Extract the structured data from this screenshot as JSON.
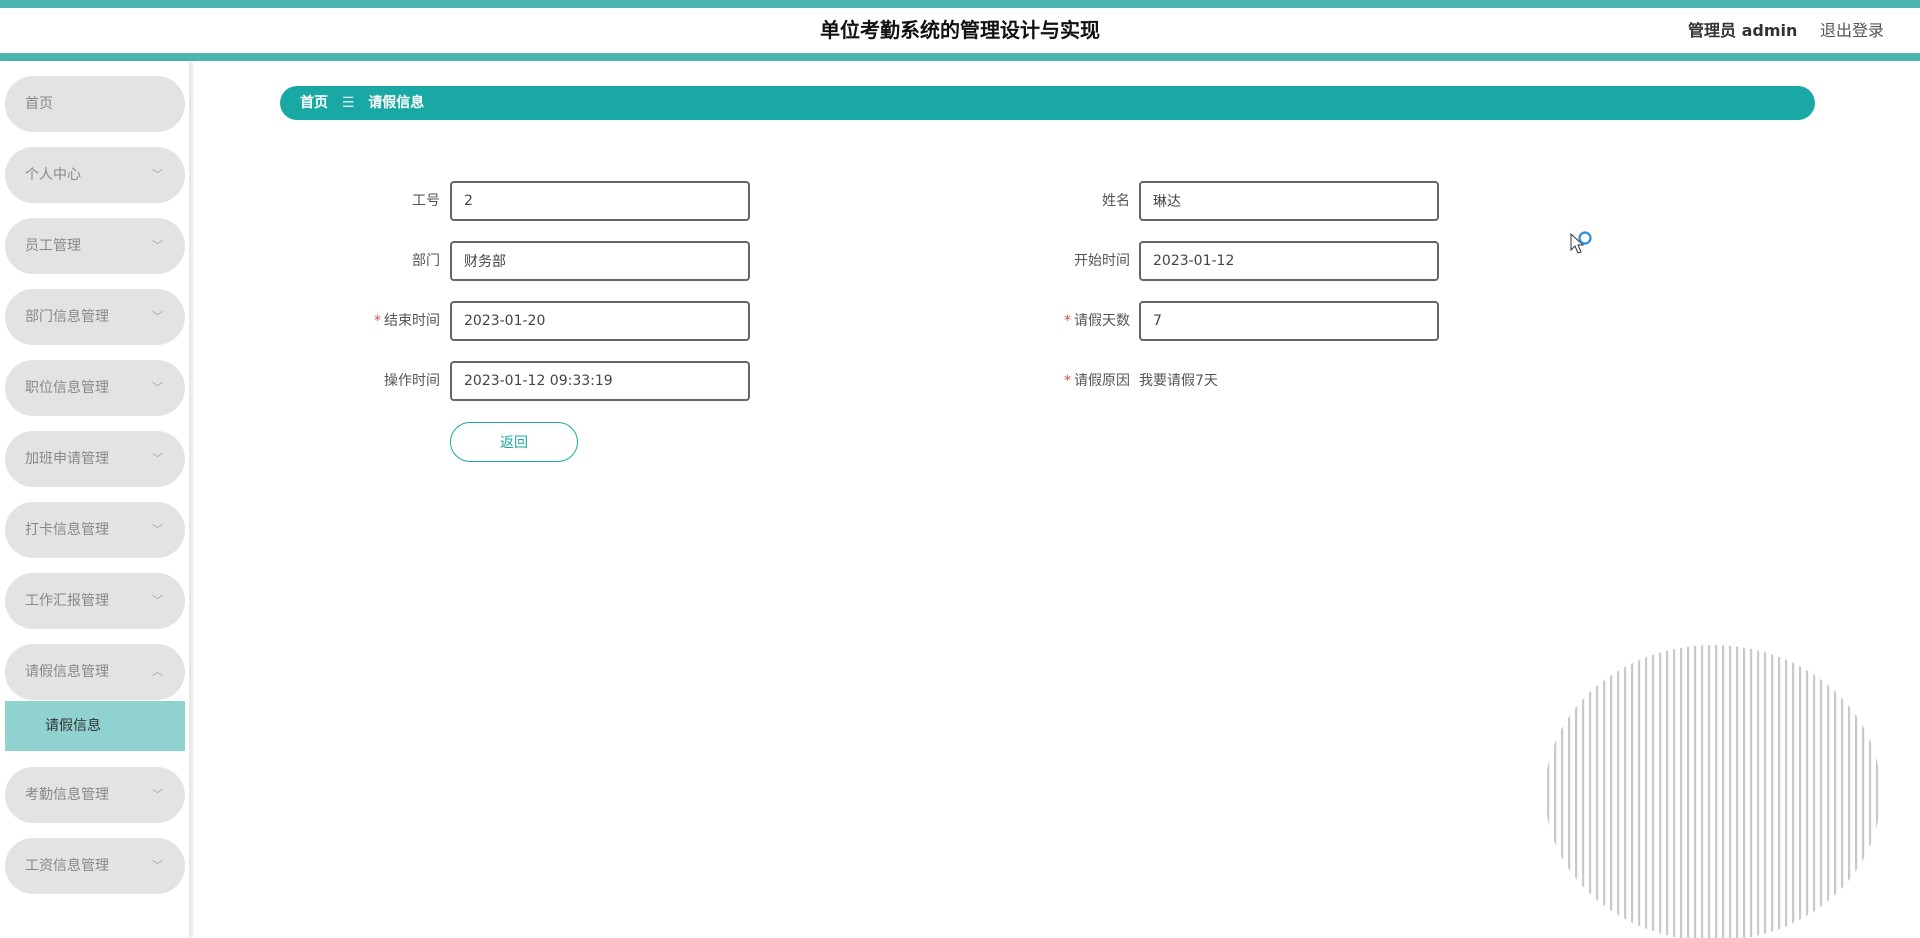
{
  "header": {
    "title": "单位考勤系统的管理设计与实现",
    "user_label": "管理员 admin",
    "logout_label": "退出登录"
  },
  "sidebar": {
    "items": [
      {
        "label": "首页"
      },
      {
        "label": "个人中心"
      },
      {
        "label": "员工管理"
      },
      {
        "label": "部门信息管理"
      },
      {
        "label": "职位信息管理"
      },
      {
        "label": "加班申请管理"
      },
      {
        "label": "打卡信息管理"
      },
      {
        "label": "工作汇报管理"
      },
      {
        "label": "请假信息管理"
      },
      {
        "label": "考勤信息管理"
      },
      {
        "label": "工资信息管理"
      }
    ],
    "submenu": {
      "label": "请假信息"
    }
  },
  "breadcrumb": {
    "home": "首页",
    "separator": "☰",
    "current": "请假信息"
  },
  "form": {
    "employee_no": {
      "label": "工号",
      "value": "2"
    },
    "name": {
      "label": "姓名",
      "value": "琳达"
    },
    "department": {
      "label": "部门",
      "value": "财务部"
    },
    "start_time": {
      "label": "开始时间",
      "value": "2023-01-12"
    },
    "end_time": {
      "label": "结束时间",
      "value": "2023-01-20",
      "required": true
    },
    "leave_days": {
      "label": "请假天数",
      "value": "7",
      "required": true
    },
    "operate_time": {
      "label": "操作时间",
      "value": "2023-01-12 09:33:19"
    },
    "leave_reason": {
      "label": "请假原因",
      "value": "我要请假7天",
      "required": true
    },
    "required_mark": "*",
    "back_button": "返回"
  },
  "colors": {
    "accent": "#1aa8a4",
    "stripe": "#4db6b3",
    "menu_bg": "#e3e3e3",
    "submenu_active_bg": "#8fd2cf",
    "required": "#e04b4b"
  }
}
